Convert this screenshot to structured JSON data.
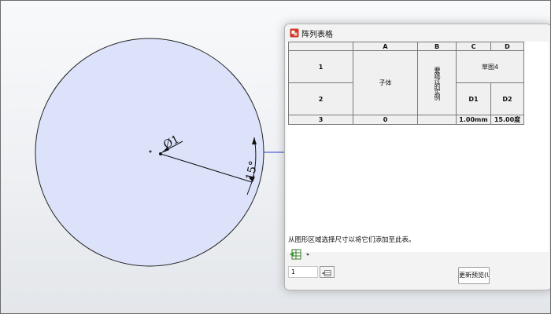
{
  "viewport": {
    "dimension_diameter": "Ø1",
    "dimension_angle": "15°"
  },
  "dialog": {
    "title": "阵列表格",
    "table": {
      "col_headers": [
        "A",
        "B",
        "C",
        "D"
      ],
      "row_headers": [
        "1",
        "2",
        "3"
      ],
      "body_label": "子体",
      "suppress_label": "要跳过的实例",
      "sketch_label": "草图4",
      "dim_names": [
        "D1",
        "D2"
      ],
      "row3": {
        "a": "0",
        "c": "1.00mm",
        "d": "15.00度"
      }
    },
    "hint": "从图形区域选择尺寸以将它们添加至此表。",
    "stepper_value": "1",
    "preview_button": "更新预览(U"
  },
  "colors": {
    "circle_fill": "#dbe2fa",
    "accent_blue": "#2a3fd1"
  }
}
